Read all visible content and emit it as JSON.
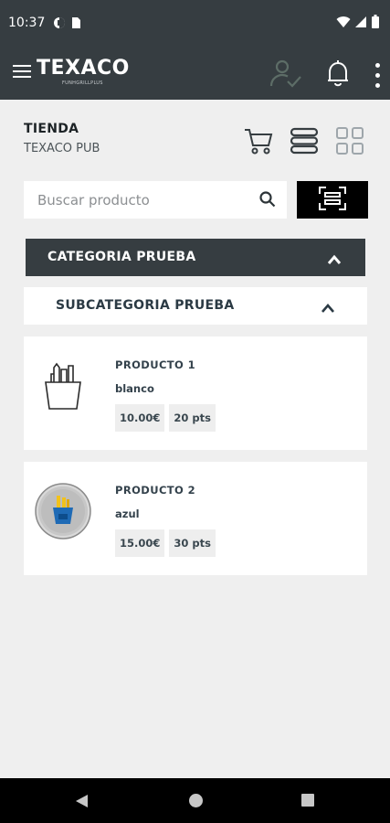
{
  "status_bar": {
    "time": "10:37",
    "icons": [
      "data-saver-icon",
      "sim-card-icon",
      "wifi-icon",
      "signal-icon",
      "battery-icon"
    ]
  },
  "app_bar": {
    "brand": "TEXACO",
    "brand_sub": "FUNHGRILLPLUS",
    "icons": [
      "menu-icon",
      "user-check-icon",
      "bell-icon",
      "more-vert-icon"
    ],
    "accent_disabled": "#5d6d67"
  },
  "store": {
    "label": "TIENDA",
    "name": "TEXACO PUB"
  },
  "view_icons": [
    "cart-icon",
    "list-view-icon",
    "grid-view-icon"
  ],
  "search": {
    "placeholder": "Buscar producto",
    "value": ""
  },
  "category": {
    "title": "CATEGORIA PRUEBA",
    "expanded": true
  },
  "subcategory": {
    "title": "SUBCATEGORIA PRUEBA",
    "expanded": true
  },
  "products": [
    {
      "name": "PRODUCTO 1",
      "color": "blanco",
      "price": "10.00€",
      "points": "20 pts",
      "image": "cup-outline-icon"
    },
    {
      "name": "PRODUCTO 2",
      "color": "azul",
      "price": "15.00€",
      "points": "30 pts",
      "image": "cup-blue-icon"
    }
  ],
  "colors": {
    "header_bg": "#363d41",
    "page_bg": "#efefef",
    "scan_bg": "#000000"
  }
}
